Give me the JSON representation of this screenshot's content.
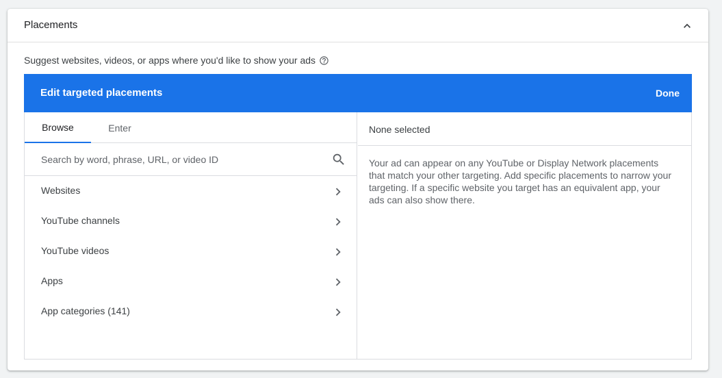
{
  "card": {
    "title": "Placements",
    "suggest_text": "Suggest websites, videos, or apps where you'd like to show your ads"
  },
  "editor": {
    "title": "Edit targeted placements",
    "done_label": "Done"
  },
  "tabs": [
    {
      "label": "Browse",
      "active": true
    },
    {
      "label": "Enter",
      "active": false
    }
  ],
  "search": {
    "placeholder": "Search by word, phrase, URL, or video ID",
    "value": ""
  },
  "categories": [
    {
      "label": "Websites"
    },
    {
      "label": "YouTube channels"
    },
    {
      "label": "YouTube videos"
    },
    {
      "label": "Apps"
    },
    {
      "label": "App categories (141)"
    }
  ],
  "selection": {
    "status": "None selected",
    "description": "Your ad can appear on any YouTube or Display Network placements that match your other targeting. Add specific placements to narrow your targeting. If a specific website you target has an equivalent app, your ads can also show there."
  },
  "colors": {
    "accent": "#1a73e8",
    "icon": "#5f6368"
  },
  "icons": {
    "collapse": "chevron-up-icon",
    "help": "help-circle-icon",
    "search": "search-icon",
    "row_chevron": "chevron-right-icon"
  }
}
